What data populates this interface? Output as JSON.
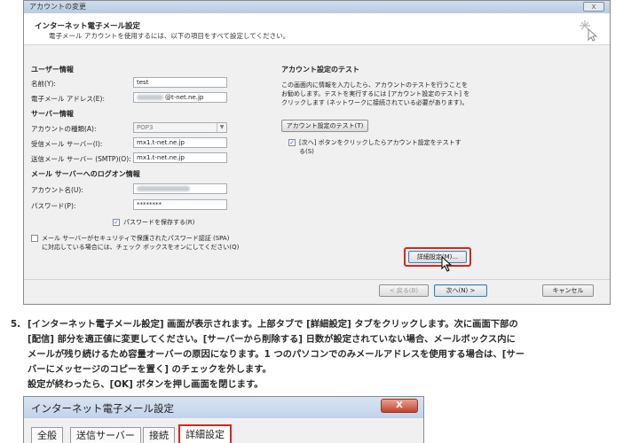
{
  "window1": {
    "title": "アカウントの変更",
    "close_label": "X",
    "header_title": "インターネット電子メール設定",
    "header_subtitle": "電子メール アカウントを使用するには、以下の項目をすべて設定してください。"
  },
  "form": {
    "user_info": "ユーザー情報",
    "name_label": "名前(Y):",
    "name_value": "test",
    "email_label": "電子メール アドレス(E):",
    "email_value": "@t-net.ne.jp",
    "server_info": "サーバー情報",
    "account_type_label": "アカウントの種類(A):",
    "account_type_value": "POP3",
    "incoming_label": "受信メール サーバー(I):",
    "incoming_value": "mx1.t-net.ne.jp",
    "outgoing_label": "送信メール サーバー (SMTP)(O):",
    "outgoing_value": "mx1.t-net.ne.jp",
    "logon_info": "メール サーバーへのログオン情報",
    "account_name_label": "アカウント名(U):",
    "password_label": "パスワード(P):",
    "password_value": "********",
    "save_password_label": "パスワードを保存する(R)",
    "spa_label_1": "メール サーバーがセキュリティで保護されたパスワード認証 (SPA)",
    "spa_label_2": "に対応している場合には、チェック ボックスをオンにしてください(Q)"
  },
  "test_panel": {
    "title": "アカウント設定のテスト",
    "desc_1": "この画面内に情報を入力したら、アカウントのテストを行うことを",
    "desc_2": "お勧めします。テストを実行するには [アカウント設定のテスト] を",
    "desc_3": "クリックします (ネットワークに接続されている必要があります)。",
    "test_button": "アカウント設定のテスト(T)",
    "next_check_1": "[次へ] ボタンをクリックしたらアカウント設定をテストす",
    "next_check_2": "る(S)",
    "detail_button": "詳細設定(M)..."
  },
  "nav": {
    "back": "< 戻る(B)",
    "next": "次へ(N) >",
    "cancel": "キャンセル"
  },
  "instructions": {
    "number": "5.",
    "line1": "[インターネット電子メール設定] 画面が表示されます。上部タブで [詳細設定] タブをクリックします。次に画面下部の",
    "line2": "[配信] 部分を適正値に変更してください。[サーバーから削除する] 日数が設定されていない場合、メールボックス内に",
    "line3": "メールが残り続けるため容量オーバーの原因になります。1 つのパソコンでのみメールアドレスを使用する場合は、[サー",
    "line4": "バーにメッセージのコピーを置く] のチェックを外します。",
    "line5": "設定が終わったら、[OK] ボタンを押し画面を閉じます。"
  },
  "window2": {
    "title": "インターネット電子メール設定",
    "close_label": "X",
    "tabs": [
      "全般",
      "送信サーバー",
      "接続",
      "詳細設定"
    ]
  },
  "colors": {
    "highlight": "#d7261e",
    "titlebar": "#c2d3e9"
  }
}
